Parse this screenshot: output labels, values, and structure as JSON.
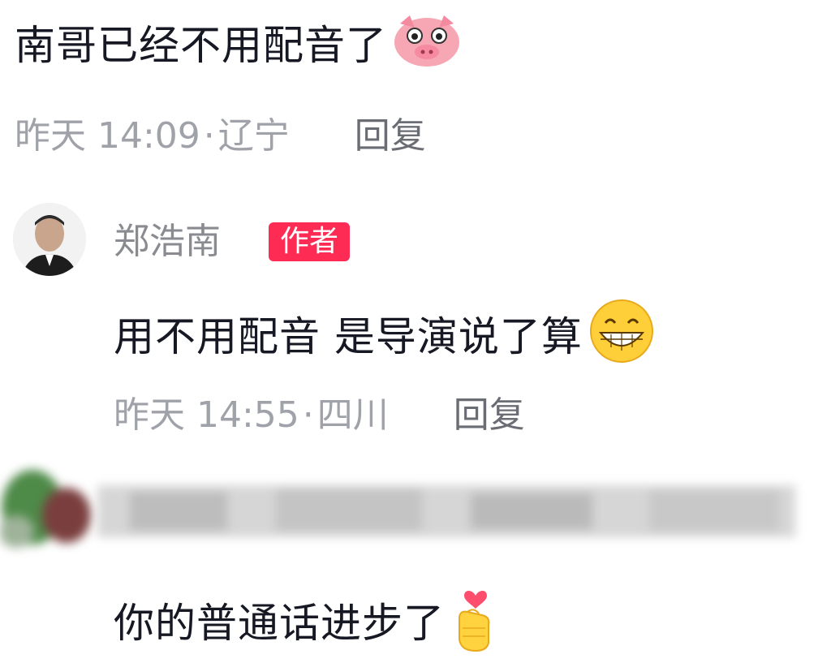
{
  "comments": [
    {
      "text": "南哥已经不用配音了",
      "emoji": "pig-face-icon",
      "time": "昨天 14:09",
      "sep": "·",
      "location": "辽宁",
      "reply_label": "回复"
    },
    {
      "username": "郑浩南",
      "badge": "作者",
      "text": "用不用配音 是导演说了算",
      "emoji": "grin-face-icon",
      "time": "昨天 14:55",
      "sep": "·",
      "location": "四川",
      "reply_label": "回复"
    },
    {
      "text": "你的普通话进步了",
      "emoji": "finger-heart-icon"
    }
  ],
  "colors": {
    "badge": "#fe2c55",
    "meta": "#a0a2a9",
    "text": "#161823"
  }
}
